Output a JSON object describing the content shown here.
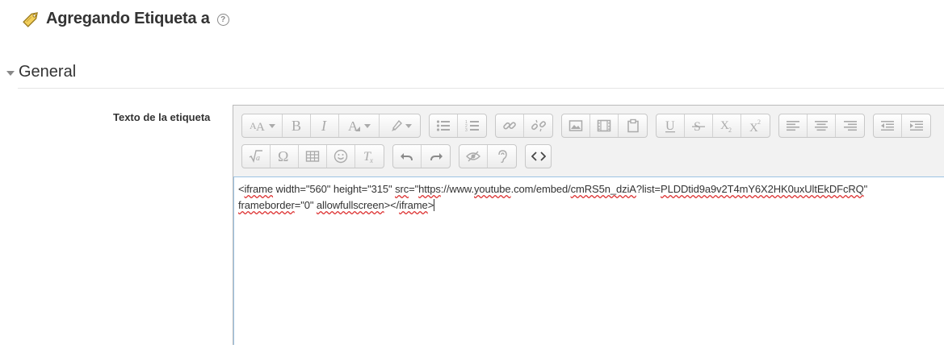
{
  "page": {
    "title": "Agregando Etiqueta a",
    "help_glyph": "?",
    "tag_icon": "tag-icon",
    "help_icon": "question-circle-icon"
  },
  "section": {
    "title": "General",
    "collapse_icon": "caret-down-icon"
  },
  "field": {
    "label": "Texto de la etiqueta"
  },
  "toolbar": {
    "rows": [
      [
        [
          "font-size",
          "bold",
          "italic",
          "font-color",
          "highlight"
        ],
        [
          "unordered-list",
          "ordered-list"
        ],
        [
          "link",
          "unlink"
        ],
        [
          "image",
          "media",
          "manage-files"
        ],
        [
          "underline",
          "strikethrough",
          "subscript",
          "superscript"
        ],
        [
          "align-left",
          "align-center",
          "align-right"
        ],
        [
          "outdent",
          "indent"
        ]
      ],
      [
        [
          "equation",
          "special-character",
          "table",
          "emoticon",
          "clear-formatting"
        ],
        [
          "undo",
          "redo"
        ],
        [
          "accessibility-checker",
          "screenreader-helper"
        ],
        [
          "html-source"
        ]
      ]
    ],
    "active_button": "html-source"
  },
  "editor": {
    "line1": {
      "p1": "<",
      "s1": "iframe",
      "p2": " width=\"560\" height=\"315\" ",
      "s2": "src",
      "p3": "=\"",
      "s3": "https",
      "p4": "://www.",
      "s4": "youtube",
      "p5": ".com/embed/",
      "s5": "cmRS5n_dziA",
      "p6": "?list=",
      "s6": "PLDDtid9a9v2T4mY6X2HK0uxUltEkDFcRQ",
      "p7": "\""
    },
    "line2": {
      "s1": "frameborder",
      "p1": "=\"0\" ",
      "s2": "allowfullscreen",
      "p2": "></",
      "s3": "iframe",
      "p3": ">"
    }
  }
}
